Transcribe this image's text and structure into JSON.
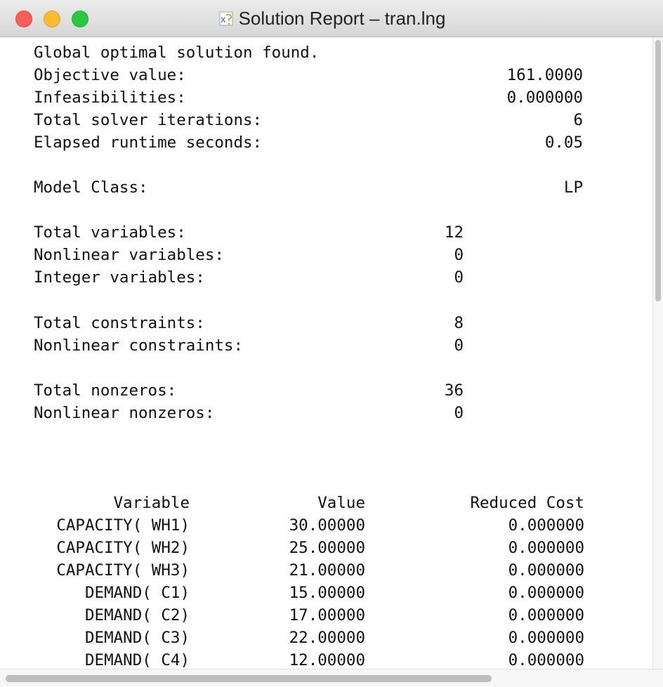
{
  "window": {
    "title": "Solution Report – tran.lng",
    "icon": "document-icon"
  },
  "summary": {
    "status": "Global optimal solution found.",
    "rows": [
      {
        "label": "Objective value:",
        "value": "161.0000"
      },
      {
        "label": "Infeasibilities:",
        "value": "0.000000"
      },
      {
        "label": "Total solver iterations:",
        "value": "6"
      },
      {
        "label": "Elapsed runtime seconds:",
        "value": "0.05"
      }
    ],
    "model_class": {
      "label": "Model Class:",
      "value": "LP"
    }
  },
  "stats": {
    "variables": [
      {
        "label": "Total variables:",
        "value": "12"
      },
      {
        "label": "Nonlinear variables:",
        "value": "0"
      },
      {
        "label": "Integer variables:",
        "value": "0"
      }
    ],
    "constraints": [
      {
        "label": "Total constraints:",
        "value": "8"
      },
      {
        "label": "Nonlinear constraints:",
        "value": "0"
      }
    ],
    "nonzeros": [
      {
        "label": "Total nonzeros:",
        "value": "36"
      },
      {
        "label": "Nonlinear nonzeros:",
        "value": "0"
      }
    ]
  },
  "table": {
    "headers": {
      "variable": "Variable",
      "value": "Value",
      "reduced_cost": "Reduced Cost"
    },
    "rows": [
      {
        "variable": "CAPACITY( WH1)",
        "value": "30.00000",
        "reduced_cost": "0.000000"
      },
      {
        "variable": "CAPACITY( WH2)",
        "value": "25.00000",
        "reduced_cost": "0.000000"
      },
      {
        "variable": "CAPACITY( WH3)",
        "value": "21.00000",
        "reduced_cost": "0.000000"
      },
      {
        "variable": "DEMAND( C1)",
        "value": "15.00000",
        "reduced_cost": "0.000000"
      },
      {
        "variable": "DEMAND( C2)",
        "value": "17.00000",
        "reduced_cost": "0.000000"
      },
      {
        "variable": "DEMAND( C3)",
        "value": "22.00000",
        "reduced_cost": "0.000000"
      },
      {
        "variable": "DEMAND( C4)",
        "value": "12.00000",
        "reduced_cost": "0.000000"
      }
    ]
  },
  "scroll": {
    "vertical_position": 0.0,
    "horizontal_position": 0.0
  }
}
